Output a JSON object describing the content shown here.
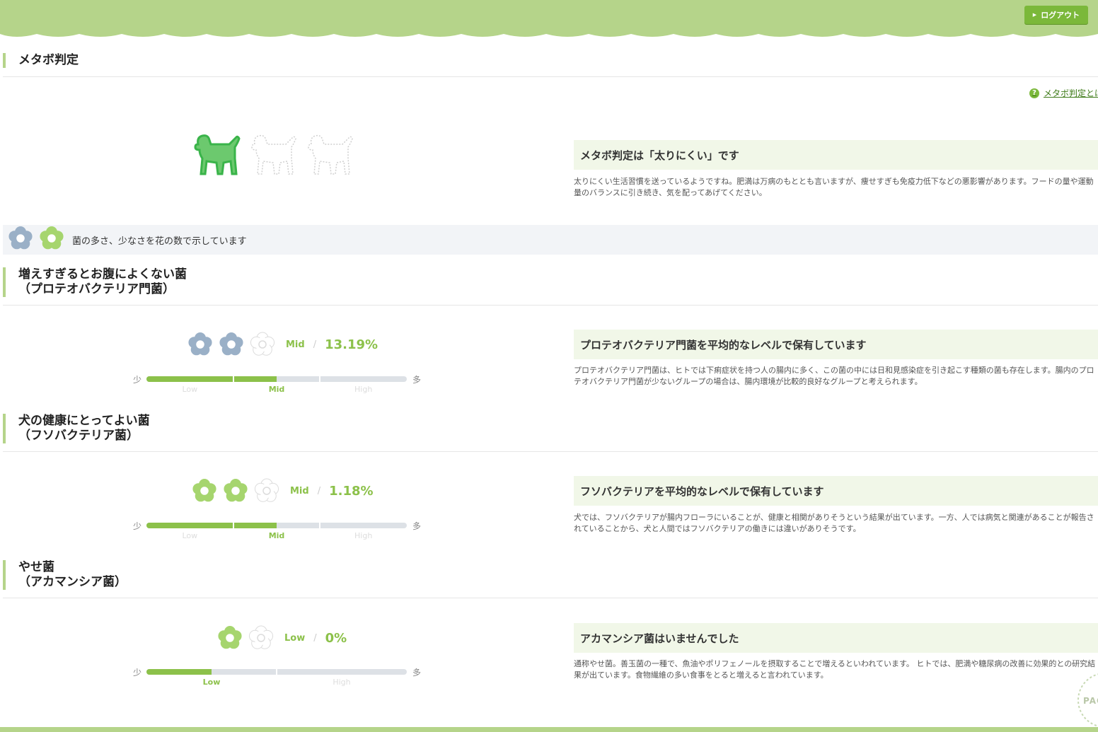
{
  "header": {
    "logout_label": "ログアウト"
  },
  "colors": {
    "accent": "#8cc14a",
    "header_bg": "#b5d48a",
    "button": "#7bb83a",
    "flower_blue": "#9ab0c7",
    "flower_green": "#a6d56e",
    "dog_green": "#3ab44a"
  },
  "metabo": {
    "title": "メタボ判定",
    "help_link": "メタボ判定とは",
    "dogs_filled": 1,
    "dogs_total": 3,
    "verdict": "メタボ判定は「太りにくい」です",
    "description": "太りにくい生活習慣を送っているようですね。肥満は万病のもととも言いますが、痩せすぎも免疫力低下などの悪影響があります。フードの量や運動量のバランスに引き続き、気を配ってあげてください。"
  },
  "legend": {
    "text": "菌の多さ、少なさを花の数で示しています"
  },
  "sections": [
    {
      "title_line1": "増えすぎるとお腹によくない菌",
      "title_line2": "（プロテオバクテリア門菌）",
      "flower_color": "blue",
      "flowers_filled": 2,
      "flowers_total": 3,
      "level": "Mid",
      "slash": "/",
      "percent": "13.19%",
      "meter_low": "少",
      "meter_high": "多",
      "meter_labels": [
        "Low",
        "Mid",
        "High"
      ],
      "meter_fill_fraction": 0.5,
      "active_label": "Mid",
      "verdict": "プロテオバクテリア門菌を平均的なレベルで保有しています",
      "description": "プロテオバクテリア門菌は、ヒトでは下痢症状を持つ人の腸内に多く、この菌の中には日和見感染症を引き起こす種類の菌も存在します。腸内のプロテオバクテリア門菌が少ないグループの場合は、腸内環境が比較的良好なグループと考えられます。"
    },
    {
      "title_line1": "犬の健康にとってよい菌",
      "title_line2": "（フソバクテリア菌）",
      "flower_color": "green",
      "flowers_filled": 2,
      "flowers_total": 3,
      "level": "Mid",
      "slash": "/",
      "percent": "1.18%",
      "meter_low": "少",
      "meter_high": "多",
      "meter_labels": [
        "Low",
        "Mid",
        "High"
      ],
      "meter_fill_fraction": 0.5,
      "active_label": "Mid",
      "verdict": "フソバクテリアを平均的なレベルで保有しています",
      "description": "犬では、フソバクテリアが腸内フローラにいることが、健康と相関がありそうという結果が出ています。一方、人では病気と関連があることが報告されていることから、犬と人間ではフソバクテリアの働きには違いがありそうです。"
    },
    {
      "title_line1": "やせ菌",
      "title_line2": "（アカマンシア菌）",
      "flower_color": "green",
      "flowers_filled": 1,
      "flowers_total": 2,
      "level": "Low",
      "slash": "/",
      "percent": "0%",
      "meter_low": "少",
      "meter_high": "多",
      "meter_labels": [
        "Low",
        "High"
      ],
      "meter_fill_fraction": 0.25,
      "active_label": "Low",
      "verdict": "アカマンシア菌はいませんでした",
      "description": "通称やせ菌。善玉菌の一種で、魚油やポリフェノールを摂取することで増えるといわれています。 ヒトでは、肥満や糖尿病の改善に効果的との研究結果が出ています。食物繊維の多い食事をとると増えると言われています。"
    }
  ],
  "page_stamp": "PAGE"
}
